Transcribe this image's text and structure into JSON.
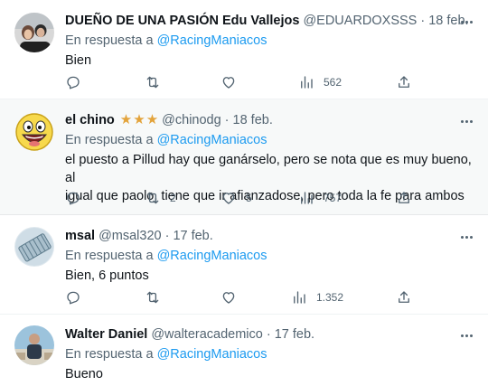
{
  "tweets": [
    {
      "name": "DUEÑO DE UNA PASIÓN Edu Vallejos",
      "handle": "@EDUARDOXSSS",
      "date": "18 feb.",
      "reply_prefix": "En respuesta a",
      "reply_to": "@RacingManiacos",
      "text": [
        "Bien"
      ],
      "replies": "",
      "retweets": "",
      "likes": "",
      "views": "562"
    },
    {
      "name": "el chino",
      "stars": 3,
      "handle": "@chinodg",
      "date": "18 feb.",
      "reply_prefix": "En respuesta a",
      "reply_to": "@RacingManiacos",
      "text": [
        "el puesto a Pillud hay que ganárselo, pero se nota que es muy bueno, al",
        "igual que paolo, tiene que ir afianzadose, pero toda la fe para ambos"
      ],
      "replies": "",
      "retweets": "2",
      "likes": "5",
      "views": "757"
    },
    {
      "name": "msal",
      "handle": "@msal320",
      "date": "17 feb.",
      "reply_prefix": "En respuesta a",
      "reply_to": "@RacingManiacos",
      "text": [
        "Bien, 6 puntos"
      ],
      "replies": "",
      "retweets": "",
      "likes": "",
      "views": "1.352"
    },
    {
      "name": "Walter Daniel",
      "handle": "@walteracademico",
      "date": "17 feb.",
      "reply_prefix": "En respuesta a",
      "reply_to": "@RacingManiacos",
      "text": [
        "Bueno"
      ]
    }
  ],
  "colors": {
    "text": "#0f1419",
    "secondary": "#536471",
    "mention": "#1d9bf0",
    "star": "#e3a33b",
    "highlight_bg": "#f7f9f9"
  },
  "icons": [
    "reply-icon",
    "retweet-icon",
    "like-icon",
    "views-icon",
    "share-icon",
    "more-icon",
    "star-icon"
  ]
}
